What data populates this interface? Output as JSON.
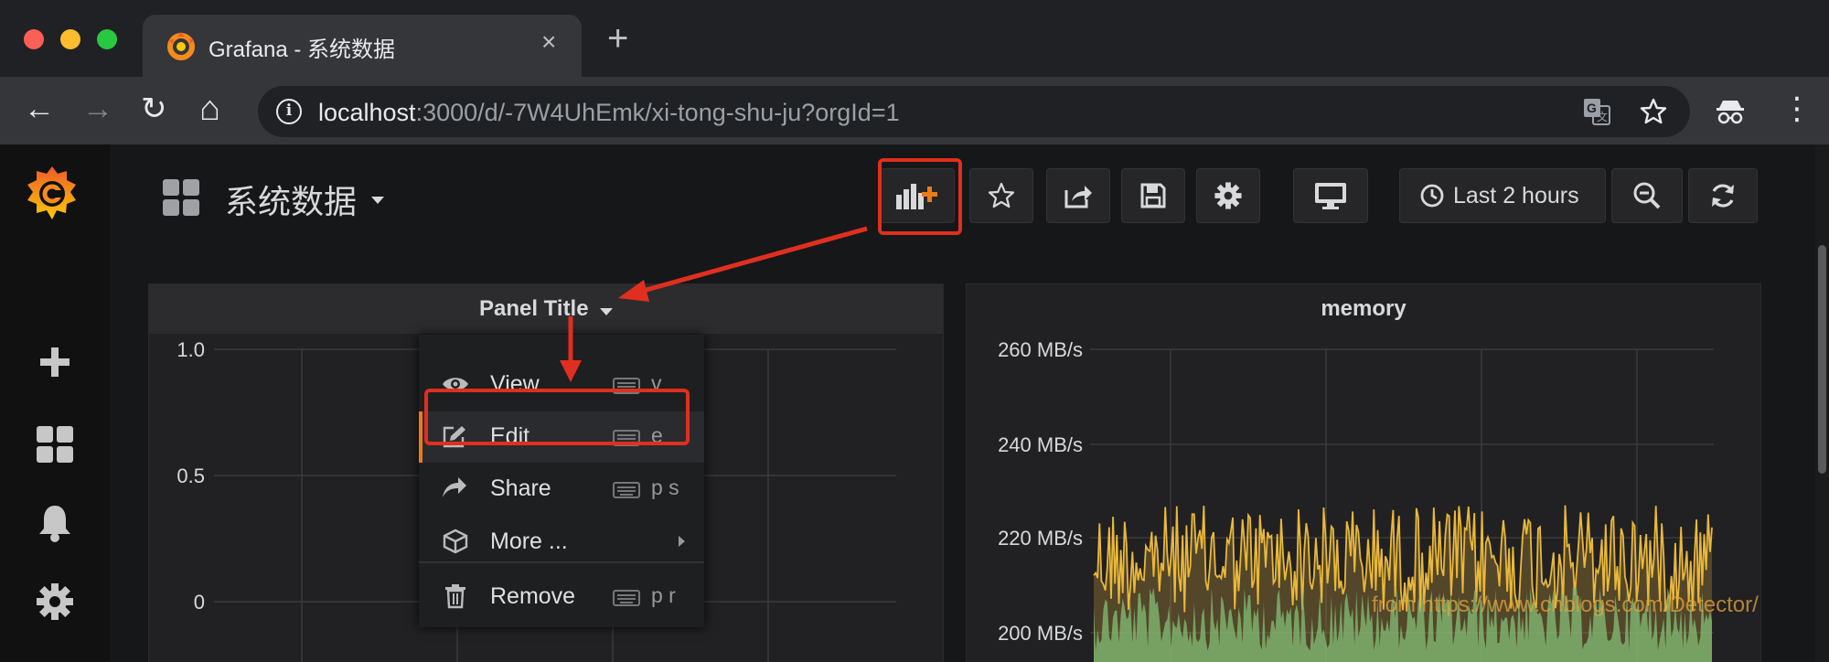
{
  "browser": {
    "tab_title": "Grafana - 系统数据",
    "tab_close": "×",
    "new_tab": "+",
    "back": "←",
    "forward": "→",
    "reload": "↻",
    "home": "⌂",
    "url_host": "localhost",
    "url_rest": ":3000/d/-7W4UhEmk/xi-tong-shu-ju?orgId=1",
    "info": "i",
    "menu_dots": "⋮"
  },
  "grafana": {
    "sidebar": [
      "create-icon",
      "dashboards-icon",
      "alerting-icon",
      "configuration-icon"
    ],
    "dashboard_title": "系统数据",
    "time_range_label": "Last 2 hours",
    "panels": [
      {
        "title": "Panel Title",
        "y_ticks": [
          "1.0",
          "0.5",
          "0"
        ]
      },
      {
        "title": "memory",
        "y_ticks": [
          "260 MB/s",
          "240 MB/s",
          "220 MB/s",
          "200 MB/s"
        ],
        "series_colors": [
          "#eab839",
          "#7eb26d"
        ]
      }
    ],
    "context_menu": [
      {
        "label": "View",
        "shortcut": "v",
        "icon": "eye-icon"
      },
      {
        "label": "Edit",
        "shortcut": "e",
        "icon": "edit-icon"
      },
      {
        "label": "Share",
        "shortcut": "p s",
        "icon": "share-icon"
      },
      {
        "label": "More ...",
        "shortcut": "",
        "icon": "cube-icon"
      },
      {
        "label": "Remove",
        "shortcut": "p r",
        "icon": "trash-icon"
      }
    ]
  },
  "watermark": "from https://www.cnblogs.com/Detector/",
  "colors": {
    "accent": "#eb7b18",
    "annotation": "#e02f1f"
  }
}
